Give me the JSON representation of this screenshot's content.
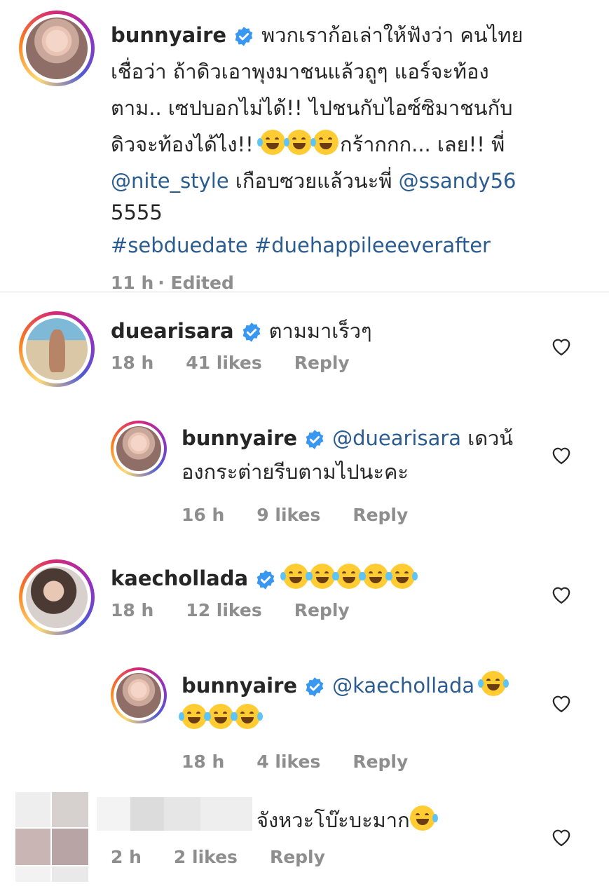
{
  "post_caption": {
    "username": "bunnyaire",
    "lines": [
      "พวกเราก้อเล่าให้ฟังว่า คนไทย",
      "เชื่อว่า ถ้าดิวเอาพุงมาชนแล้วถูๆ แอร์จะท้อง",
      "ตาม.. เซปบอกไม่ได้!! ไปชนกับไอซ์ซิมาชนกับ",
      "ดิวจะท้องได้ไง!!",
      "กร้ากกก... เลย!! พี่",
      "เกือบซวยแล้วนะพี่",
      "5555"
    ],
    "mention_1": "@nite_style",
    "mention_2": "@ssandy56",
    "hashtags": "#sebduedate #duehappileeeverafter",
    "time": "11 h",
    "edited": "· Edited"
  },
  "comments": [
    {
      "username": "duearisara",
      "text": "ตามมาเร็วๆ",
      "time": "18 h",
      "likes": "41 likes",
      "reply": "Reply"
    },
    {
      "username": "bunnyaire",
      "mention": "@duearisara",
      "text_1": "เดวน้",
      "text_2": "องกระต่ายรีบตามไปนะคะ",
      "time": "16 h",
      "likes": "9 likes",
      "reply": "Reply"
    },
    {
      "username": "kaechollada",
      "time": "18 h",
      "likes": "12 likes",
      "reply": "Reply"
    },
    {
      "username": "bunnyaire",
      "mention": "@kaechollada",
      "time": "18 h",
      "likes": "4 likes",
      "reply": "Reply"
    },
    {
      "text": "จังหวะโบ๊ะบะมาก",
      "time": "2 h",
      "likes": "2 likes",
      "reply": "Reply"
    }
  ],
  "colors": {
    "verified": "#3897f0",
    "link": "#2b5c91",
    "meta": "#8e8e8e",
    "divider": "#dbdbdb"
  },
  "icons": [
    "verified-badge-icon",
    "heart-icon",
    "laughing-face-emoji",
    "rolling-laughing-emoji",
    "sweat-smile-emoji"
  ]
}
